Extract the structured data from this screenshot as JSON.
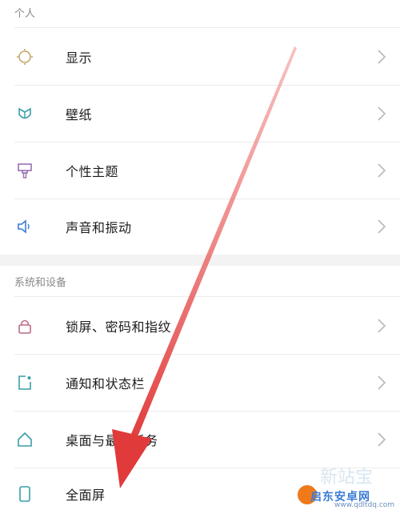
{
  "colors": {
    "accent_icon": "#3a9ea8",
    "display_icon": "#c8a66a",
    "theme_icon": "#9a6fb0",
    "sound_icon": "#3a7bd5",
    "arrow": "#e03a3a",
    "chevron": "#b8b8b8"
  },
  "sections": [
    {
      "header": "个人",
      "items": [
        {
          "label": "显示",
          "icon": "sun-icon"
        },
        {
          "label": "壁纸",
          "icon": "flower-icon"
        },
        {
          "label": "个性主题",
          "icon": "brush-icon"
        },
        {
          "label": "声音和振动",
          "icon": "speaker-icon"
        }
      ]
    },
    {
      "header": "系统和设备",
      "items": [
        {
          "label": "锁屏、密码和指纹",
          "icon": "lock-icon"
        },
        {
          "label": "通知和状态栏",
          "icon": "notification-icon"
        },
        {
          "label": "桌面与最近任务",
          "icon": "home-icon"
        },
        {
          "label": "全面屏",
          "icon": "phone-icon"
        }
      ]
    }
  ],
  "watermark": {
    "text": "启东安卓网",
    "url": "www.qdltdq.com"
  }
}
